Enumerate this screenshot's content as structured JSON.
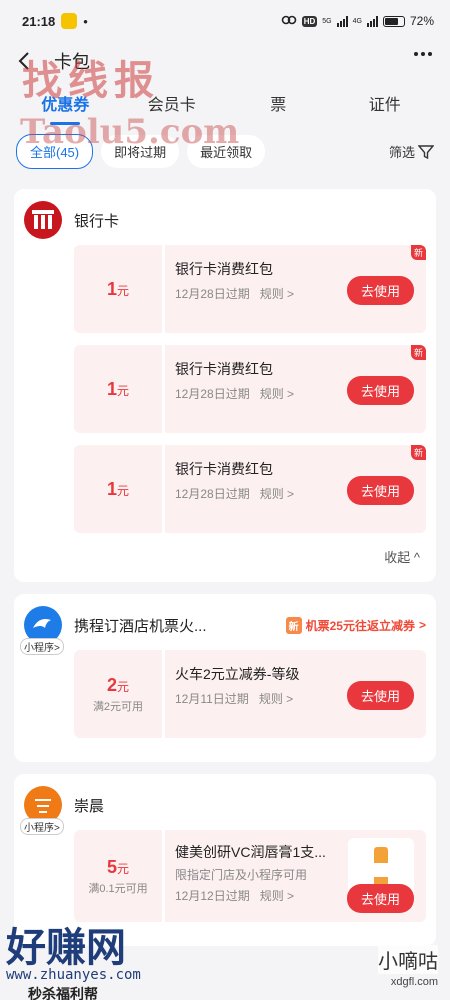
{
  "status": {
    "time": "21:18",
    "hd": "HD",
    "net1": "5G",
    "net2": "4G",
    "battery": "72%"
  },
  "header": {
    "title": "卡包"
  },
  "watermarks": {
    "top": "找线报",
    "url": "Taolu5.com",
    "bottom": "好赚网",
    "bottom_site": "www.zhuanyes.com",
    "xiaodigu": "小嘀咕",
    "xdg_site": "xdgfl.com"
  },
  "tabs": [
    "优惠券",
    "会员卡",
    "票",
    "证件"
  ],
  "filters": {
    "all": "全部(45)",
    "expiring": "即将过期",
    "recent": "最近领取",
    "filter": "筛选"
  },
  "cards": {
    "bank": {
      "name": "银行卡",
      "coupons": [
        {
          "amount": "1",
          "unit": "元",
          "title": "银行卡消费红包",
          "expire": "12月28日过期",
          "rule": "规则 >",
          "action": "去使用",
          "badge": "新"
        },
        {
          "amount": "1",
          "unit": "元",
          "title": "银行卡消费红包",
          "expire": "12月28日过期",
          "rule": "规则 >",
          "action": "去使用",
          "badge": "新"
        },
        {
          "amount": "1",
          "unit": "元",
          "title": "银行卡消费红包",
          "expire": "12月28日过期",
          "rule": "规则 >",
          "action": "去使用",
          "badge": "新"
        }
      ],
      "collapse": "收起"
    },
    "ctrip": {
      "name": "携程订酒店机票火...",
      "tag": "小程序>",
      "promo_badge": "新",
      "promo": "机票25元往返立减券",
      "coupon": {
        "amount": "2",
        "unit": "元",
        "condition": "满2元可用",
        "title": "火车2元立减券-等级",
        "expire": "12月11日过期",
        "rule": "规则 >",
        "action": "去使用"
      }
    },
    "chongchen": {
      "name": "崇晨",
      "tag": "小程序>",
      "coupon": {
        "amount": "5",
        "unit": "元",
        "condition": "满0.1元可用",
        "title": "健美创研VC润唇膏1支...",
        "sub": "限指定门店及小程序可用",
        "expire": "12月12日过期",
        "rule": "规则 >",
        "action": "去使用"
      }
    },
    "next": {
      "name": "秒杀福利帮"
    }
  }
}
